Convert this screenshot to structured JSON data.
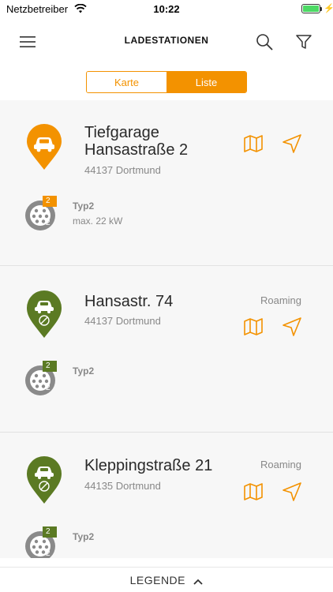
{
  "status_bar": {
    "carrier": "Netzbetreiber",
    "time": "10:22"
  },
  "header": {
    "title": "LADESTATIONEN"
  },
  "segmented": {
    "map_label": "Karte",
    "list_label": "Liste",
    "selected": "Liste"
  },
  "colors": {
    "accent": "#f39200",
    "roaming_green": "#5b7a23",
    "plug_gray": "#8a8a8a"
  },
  "stations": [
    {
      "name_line1": "Tiefgarage",
      "name_line2": "Hansastraße 2",
      "city": "44137 Dortmund",
      "roaming": "",
      "pin_color": "orange",
      "connector": {
        "availability": "2 / 2",
        "type": "Typ2",
        "power": "max. 22 kW"
      }
    },
    {
      "name_line1": "Hansastr. 74",
      "name_line2": "",
      "city": "44137 Dortmund",
      "roaming": "Roaming",
      "pin_color": "green",
      "connector": {
        "availability": "2 / 2",
        "type": "Typ2",
        "power": ""
      }
    },
    {
      "name_line1": "Kleppingstraße 21",
      "name_line2": "",
      "city": "44135 Dortmund",
      "roaming": "Roaming",
      "pin_color": "green",
      "connector": {
        "availability": "2 / 2",
        "type": "Typ2",
        "power": ""
      }
    }
  ],
  "legend": {
    "label": "LEGENDE"
  }
}
